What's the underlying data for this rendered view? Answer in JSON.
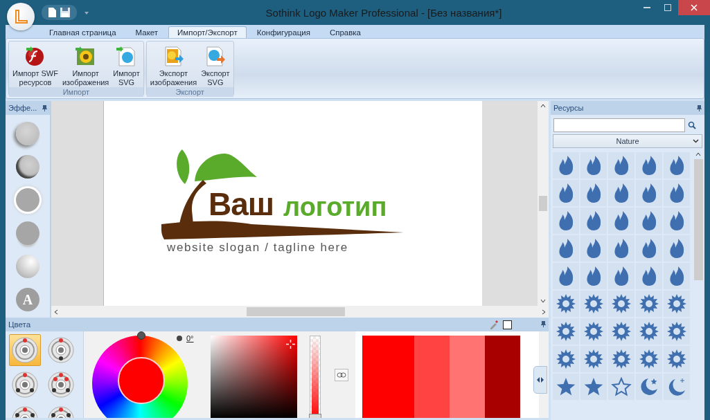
{
  "window": {
    "title": "Sothink Logo Maker Professional - [Без названия*]"
  },
  "tabs": [
    {
      "label": "Главная страница",
      "selected": false
    },
    {
      "label": "Макет",
      "selected": false
    },
    {
      "label": "Импорт/Экспорт",
      "selected": true
    },
    {
      "label": "Конфигурация",
      "selected": false
    },
    {
      "label": "Справка",
      "selected": false
    }
  ],
  "ribbon_groups": [
    {
      "label": "Импорт",
      "buttons": [
        {
          "label": "Импорт SWF\nресурсов",
          "kind": "flash"
        },
        {
          "label": "Импорт\nизображения",
          "kind": "image-in"
        },
        {
          "label": "Импорт\nSVG",
          "kind": "svg-in"
        }
      ]
    },
    {
      "label": "Экспорт",
      "buttons": [
        {
          "label": "Экспорт\nизображения",
          "kind": "image-out"
        },
        {
          "label": "Экспорт\nSVG",
          "kind": "svg-out"
        }
      ]
    }
  ],
  "effects_panel": {
    "title": "Эффе...",
    "items": [
      {
        "kind": "shadow"
      },
      {
        "kind": "bevel"
      },
      {
        "kind": "glow"
      },
      {
        "kind": "reflection"
      },
      {
        "kind": "gradient"
      },
      {
        "kind": "text",
        "text": "A"
      }
    ]
  },
  "canvas": {
    "logo": {
      "word_1": "Ваш",
      "word_2": "логотип",
      "slogan": "website slogan / tagline here"
    }
  },
  "colors_panel": {
    "title": "Цвета",
    "harmonies": [
      {
        "kind": "mono",
        "selected": true
      },
      {
        "kind": "complement",
        "selected": false
      },
      {
        "kind": "triad",
        "selected": false
      },
      {
        "kind": "tetrad",
        "selected": false
      },
      {
        "kind": "penta",
        "selected": false
      },
      {
        "kind": "split",
        "selected": false
      }
    ],
    "hue": "0°",
    "opacity": {
      "level": 1
    },
    "swatches": [
      {
        "color": "#ff0000"
      },
      {
        "color": "#ff4343"
      },
      {
        "color": "#ff7373"
      },
      {
        "color": "#a80000"
      }
    ]
  },
  "resources_panel": {
    "title": "Ресурсы",
    "category": "Nature",
    "shapes": [
      {
        "kind": "flame"
      },
      {
        "kind": "flame"
      },
      {
        "kind": "flame"
      },
      {
        "kind": "flame"
      },
      {
        "kind": "flame"
      },
      {
        "kind": "flame"
      },
      {
        "kind": "flame"
      },
      {
        "kind": "flame"
      },
      {
        "kind": "flame"
      },
      {
        "kind": "flame"
      },
      {
        "kind": "flame"
      },
      {
        "kind": "flame"
      },
      {
        "kind": "flame"
      },
      {
        "kind": "flame"
      },
      {
        "kind": "flame"
      },
      {
        "kind": "flame"
      },
      {
        "kind": "flame"
      },
      {
        "kind": "flame"
      },
      {
        "kind": "flame"
      },
      {
        "kind": "flame"
      },
      {
        "kind": "flame"
      },
      {
        "kind": "flame"
      },
      {
        "kind": "flame"
      },
      {
        "kind": "flame"
      },
      {
        "kind": "flame"
      },
      {
        "kind": "sun"
      },
      {
        "kind": "sun"
      },
      {
        "kind": "sun"
      },
      {
        "kind": "sun"
      },
      {
        "kind": "sun"
      },
      {
        "kind": "sun"
      },
      {
        "kind": "sun"
      },
      {
        "kind": "sun"
      },
      {
        "kind": "sun"
      },
      {
        "kind": "sun"
      },
      {
        "kind": "sun"
      },
      {
        "kind": "sun"
      },
      {
        "kind": "sun"
      },
      {
        "kind": "sun"
      },
      {
        "kind": "sun"
      },
      {
        "kind": "star"
      },
      {
        "kind": "star"
      },
      {
        "kind": "star-outline"
      },
      {
        "kind": "moon-star"
      },
      {
        "kind": "moon"
      }
    ]
  }
}
